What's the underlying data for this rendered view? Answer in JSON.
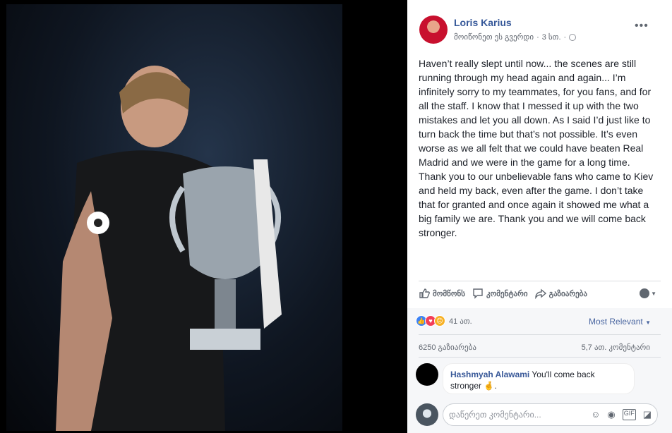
{
  "post": {
    "author": "Loris Karius",
    "subtitle": "მოიწონეთ ეს გვერდი",
    "time": "3 სთ.",
    "more_label": "•••",
    "text": "Haven’t really slept until now... the scenes are still running through my head again and again... I’m infinitely sorry to my teammates, for you fans, and for all the staff. I know that I messed it up with the two mistakes and let you all down. As I said I’d just like to turn back the time but that’s not possible. It’s even worse as we all felt that we could have beaten Real Madrid and we were in the game for a long time. Thank you to our unbelievable fans who came to Kiev and held my back, even after the game. I don’t take that for granted and once again it showed me what a big family we are. Thank you and we will come back stronger."
  },
  "actions": {
    "like": "მომწონს",
    "comment": "კომენტარი",
    "share": "გაზიარება"
  },
  "reactions": {
    "count": "41 ათ.",
    "sort_label": "Most Relevant",
    "shares": "6250 გაზიარება",
    "comments": "5,7 ათ. კომენტარი"
  },
  "comment": {
    "name": "Hashmyah Alawami",
    "text": "You'll come back stronger",
    "suffix": "."
  },
  "composer": {
    "placeholder": "დაწერეთ კომენტარი..."
  },
  "colors": {
    "link": "#365899",
    "like_blue": "#3b82f6",
    "love_red": "#f33e58",
    "sad_yellow": "#f7b125"
  }
}
